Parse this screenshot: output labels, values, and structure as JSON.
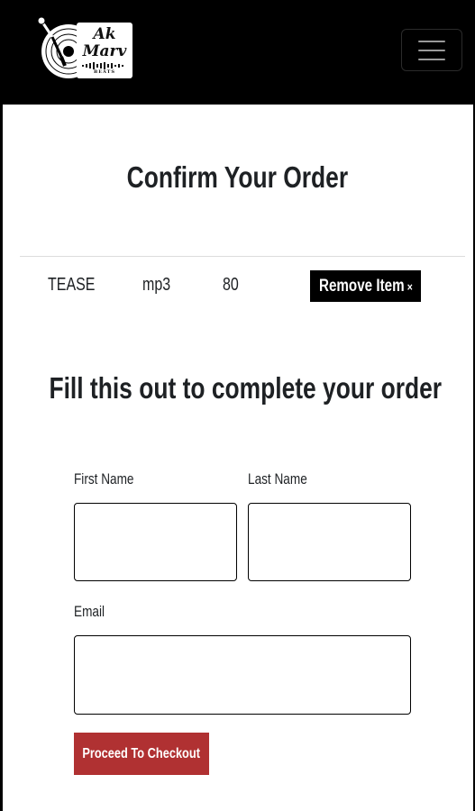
{
  "navbar": {
    "logo": {
      "line1": "Ak",
      "line2": "Marv",
      "line3": "BEATS"
    },
    "menu_icon": "hamburger-icon"
  },
  "page": {
    "title": "Confirm Your Order",
    "subtitle": "Fill this out to complete your order"
  },
  "order_item": {
    "name": "TEASE",
    "format": "mp3",
    "price": "80",
    "remove_label": "Remove Item",
    "remove_icon": "×"
  },
  "form": {
    "first_name_label": "First Name",
    "first_name_value": "",
    "last_name_label": "Last Name",
    "last_name_value": "",
    "email_label": "Email",
    "email_value": "",
    "submit_label": "Proceed To Checkout"
  },
  "colors": {
    "navbar": "#000000",
    "checkout_button": "#b03132",
    "remove_button": "#000000",
    "text": "#1e2124"
  }
}
